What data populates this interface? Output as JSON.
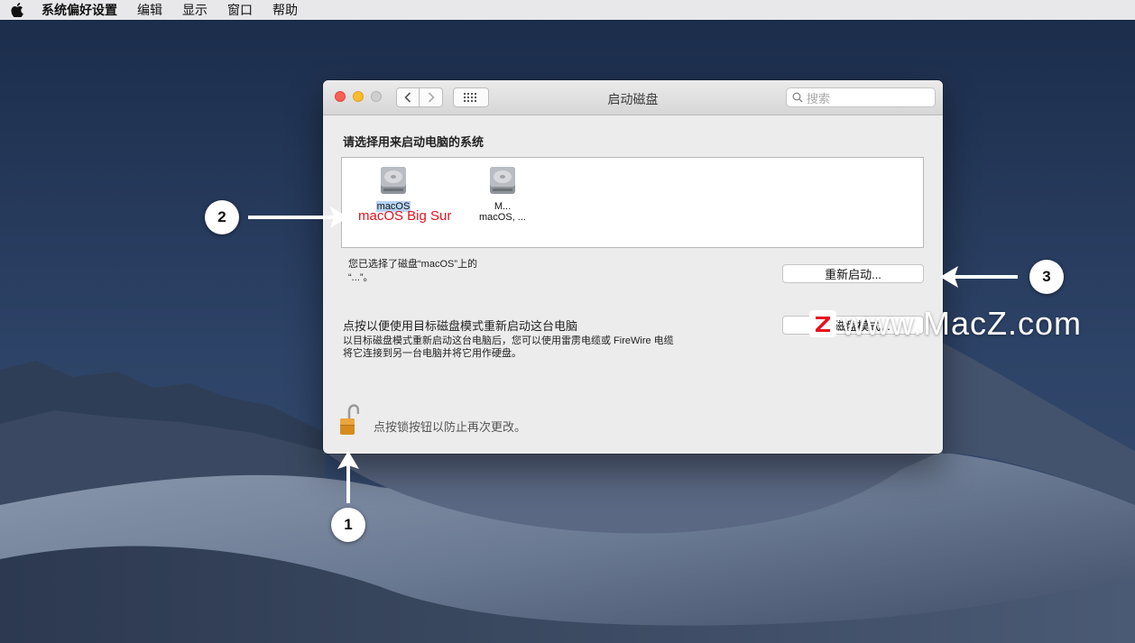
{
  "menubar": {
    "apple_icon": "apple-logo",
    "items": [
      "系统偏好设置",
      "编辑",
      "显示",
      "窗口",
      "帮助"
    ]
  },
  "window": {
    "title": "启动磁盘",
    "search_placeholder": "搜索",
    "prompt": "请选择用来启动电脑的系统",
    "disks": [
      {
        "name": "macOS",
        "subtitle": "",
        "selected": true,
        "annotation": "macOS Big Sur"
      },
      {
        "name": "M...",
        "subtitle": "macOS, ...",
        "selected": false
      }
    ],
    "selected_line1": "您已选择了磁盘“macOS”上的",
    "selected_line2": "“...”。",
    "restart_button": "重新启动...",
    "target_disk_mode_title": "点按以便使用目标磁盘模式重新启动这台电脑",
    "target_disk_mode_desc1": "以目标磁盘模式重新启动这台电脑后，您可以使用雷雳电缆或 FireWire 电缆",
    "target_disk_mode_desc2": "将它连接到另一台电脑并将它用作硬盘。",
    "target_disk_mode_button": "目标磁盘模式...",
    "lock_text": "点按锁按钮以防止再次更改。"
  },
  "annotations": [
    "1",
    "2",
    "3"
  ],
  "watermark": "www.MacZ.com",
  "colors": {
    "annotation_red": "#e8111e",
    "selection_blue": "#b7d3f7",
    "close": "#fc5f57",
    "minimize": "#fdbc2e"
  }
}
